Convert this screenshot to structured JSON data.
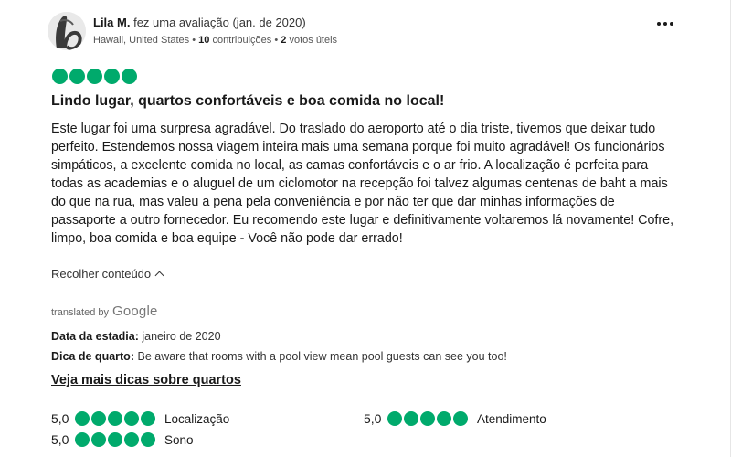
{
  "reviewer": {
    "name": "Lila M.",
    "action": "fez uma avaliação (jan. de 2020)",
    "location": "Hawaii, United States",
    "separator": "•",
    "contributions_count": "10",
    "contributions_label": "contribuições",
    "votes_count": "2",
    "votes_label": "votos úteis"
  },
  "review": {
    "rating": 5,
    "title": "Lindo lugar, quartos confortáveis e boa comida no local!",
    "body": "Este lugar foi uma surpresa agradável. Do traslado do aeroporto até o dia triste, tivemos que deixar tudo perfeito. Estendemos nossa viagem inteira mais uma semana porque foi muito agradável! Os funcionários simpáticos, a excelente comida no local, as camas confortáveis e o ar frio. A localização é perfeita para todas as academias e o aluguel de um ciclomotor na recepção foi talvez algumas centenas de baht a mais do que na rua, mas valeu a pena pela conveniência e por não ter que dar minhas informações de passaporte a outro fornecedor. Eu recomendo este lugar e definitivamente voltaremos lá novamente! Cofre, limpo, boa comida e boa equipe - Você não pode dar errado!",
    "collapse_label": "Recolher conteúdo"
  },
  "translation": {
    "prefix": "translated by",
    "provider": "Google"
  },
  "details": {
    "stay_label": "Data da estadia:",
    "stay_value": "janeiro de 2020",
    "tip_label": "Dica de quarto:",
    "tip_value": "Be aware that rooms with a pool view mean pool guests can see you too!",
    "more_tips_label": "Veja mais dicas sobre quartos"
  },
  "sub_ratings": [
    {
      "score": "5,0",
      "value": 5,
      "label": "Localização"
    },
    {
      "score": "5,0",
      "value": 5,
      "label": "Atendimento"
    },
    {
      "score": "5,0",
      "value": 5,
      "label": "Sono"
    }
  ],
  "colors": {
    "bubble": "#00aa6c",
    "text": "#1a1a1a"
  },
  "icons": {
    "menu": "more-horizontal-icon",
    "collapse": "chevron-up-icon"
  }
}
